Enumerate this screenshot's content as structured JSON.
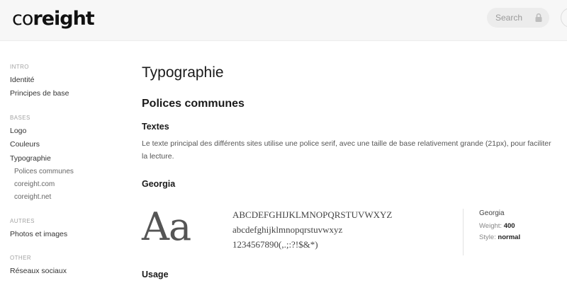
{
  "header": {
    "logo_text_light": "co",
    "logo_text_bold": "reight",
    "search_placeholder": "Search",
    "lock_icon": "lock-icon"
  },
  "sidebar": {
    "sections": [
      {
        "label": "INTRO",
        "items": [
          "Identité",
          "Principes de base"
        ]
      },
      {
        "label": "BASES",
        "items": [
          "Logo",
          "Couleurs",
          "Typographie"
        ],
        "sub_items": [
          "Polices communes",
          "coreight.com",
          "coreight.net"
        ]
      },
      {
        "label": "AUTRES",
        "items": [
          "Photos et images"
        ]
      },
      {
        "label": "OTHER",
        "items": [
          "Réseaux sociaux"
        ]
      }
    ]
  },
  "main": {
    "page_title": "Typographie",
    "section_title": "Polices communes",
    "textes_title": "Textes",
    "textes_body": "Le texte principal des différents sites utilise une police serif, avec une taille de base relativement grande (21px), pour faciliter la lecture.",
    "georgia_title": "Georgia",
    "sample": {
      "aa": "Aa",
      "uppercase": "ABCDEFGHIJKLMNOPQRSTUVWXYZ",
      "lowercase": "abcdefghijklmnopqrstuvwxyz",
      "digits": "1234567890(,.;:?!$&*)"
    },
    "meta": {
      "name": "Georgia",
      "weight_label": "Weight:",
      "weight_value": "400",
      "style_label": "Style:",
      "style_value": "normal"
    },
    "usage_title": "Usage"
  },
  "colors": {
    "header_bg": "#f7f7f7",
    "search_bg": "#ececec",
    "text_dark": "#1a1a1a",
    "text_muted": "#555555"
  }
}
